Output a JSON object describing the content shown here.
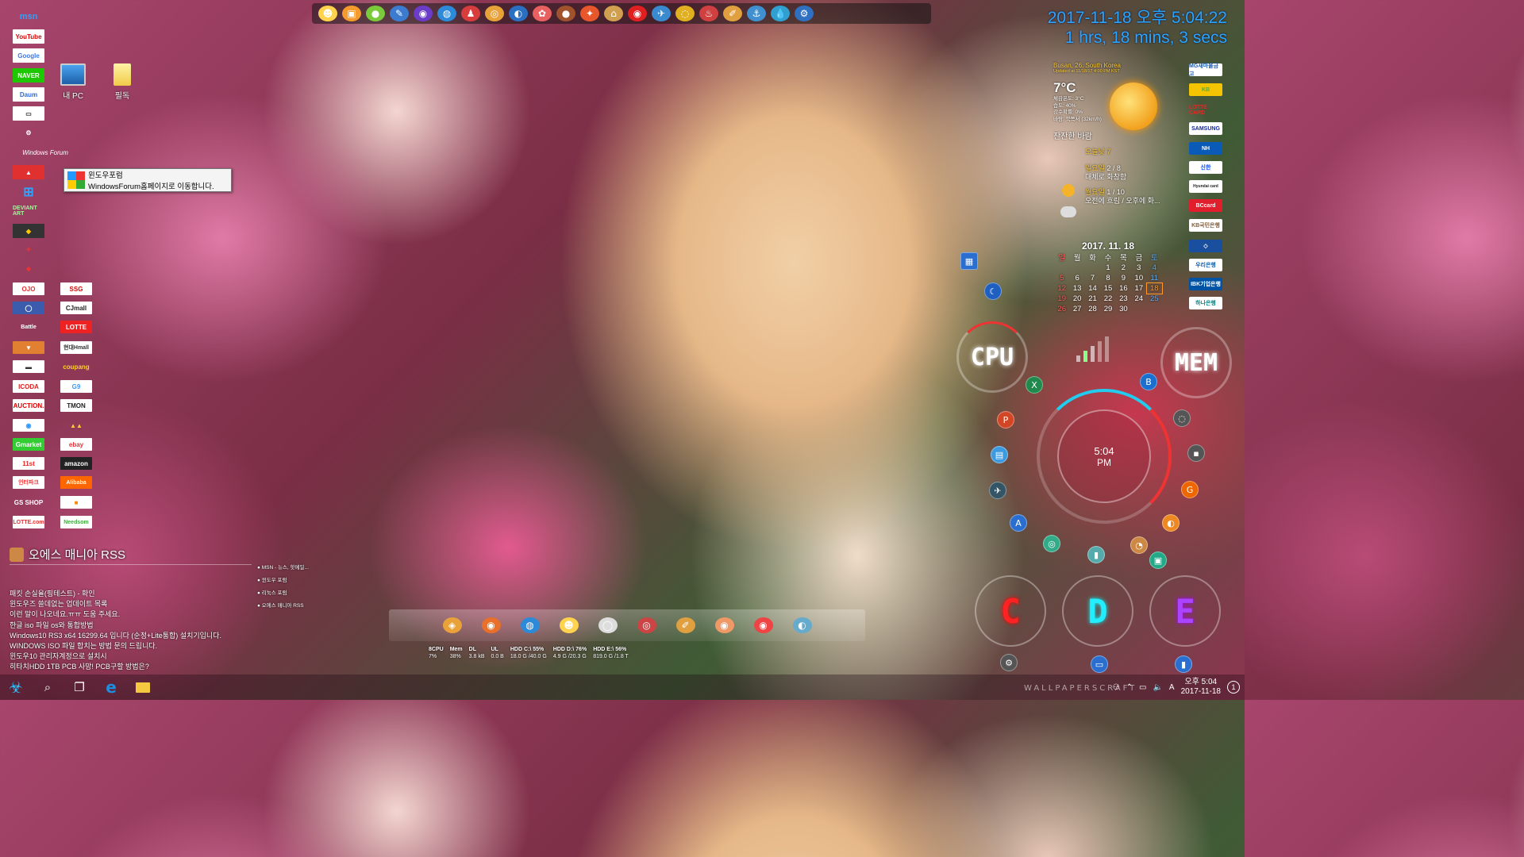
{
  "clock": {
    "datetime": "2017-11-18 오후 5:04:22",
    "uptime": "1 hrs, 18 mins, 3 secs"
  },
  "desktop_icons": [
    {
      "label": "내 PC"
    },
    {
      "label": "필독"
    }
  ],
  "tooltip": {
    "title": "윈도우포럼",
    "desc": "WindowsForum홈페이지로 이동합니다."
  },
  "left_shortcuts": [
    "msn",
    "YouTube",
    "Google",
    "NAVER",
    "Daum",
    "Windows Forum",
    "DEVIANT ART"
  ],
  "left_shortcuts_col2": [
    "CJmall",
    "LOTTE",
    "현대Hmall",
    "coupang",
    "G9",
    "TMON",
    "ebay",
    "amazon",
    "Alibaba",
    "Needsom"
  ],
  "left_shortcuts_col1b": [
    "Gmarket",
    "ICODA",
    "AUCTION.",
    "11st",
    "인터파크",
    "GS SHOP",
    "LOTTE.com"
  ],
  "rss": {
    "title": "오에스 매니아 RSS",
    "items": [
      "패킷 손실율(핑테스트) - 확인",
      "윈도우즈 쓸데없는 업데이트 목록",
      "이런 말이 나오네요.ㅠㅠ 도움 주세요.",
      "한글 iso 파일 os와 통합방법",
      "Windows10 RS3 x64 16299.64 입니다 (순정+Lite통합) 설치기입니다.",
      "WINDOWS ISO 파일 합치는 방법 문의 드립니다.",
      "윈도우10 관리자계정으로 설치시",
      "히타치HDD 1TB PCB 사망! PCB구할 방법은?"
    ],
    "links": [
      "MSN - 뉴스, 핫메일...",
      "윈도우 포럼",
      "리눅스 포럼",
      "오에스 매니아 RSS"
    ]
  },
  "weather": {
    "location": "Busan, 26, South Korea",
    "updated": "Updated at 11/18/17 4:00 PM KST",
    "temp": "7°C",
    "details": [
      "체감온도: 3°C",
      "습도: 40%",
      "강수확률: 0%",
      "바람: 북쪽서 (32km/h)"
    ],
    "condition": "잔잔한 바람",
    "today": "오늘낮 7",
    "forecast": [
      {
        "day": "일요일",
        "range": "2 / 8",
        "text": "대체로 화창함"
      },
      {
        "day": "월요일",
        "range": "1 / 10",
        "text": "오전에 흐림 / 오후에 화..."
      }
    ]
  },
  "calendar": {
    "header": "2017. 11. 18",
    "weekdays": [
      "일",
      "월",
      "화",
      "수",
      "목",
      "금",
      "토"
    ],
    "weeks": [
      [
        "",
        "",
        "",
        "1",
        "2",
        "3",
        "4"
      ],
      [
        "5",
        "6",
        "7",
        "8",
        "9",
        "10",
        "11"
      ],
      [
        "12",
        "13",
        "14",
        "15",
        "16",
        "17",
        "18"
      ],
      [
        "19",
        "20",
        "21",
        "22",
        "23",
        "24",
        "25"
      ],
      [
        "26",
        "27",
        "28",
        "29",
        "30",
        "",
        ""
      ]
    ],
    "today": "18"
  },
  "right_banks": [
    "MG새마을금고",
    "KB",
    "LOTTE CARD",
    "SAMSUNG",
    "NH",
    "신한",
    "Hyundai card",
    "BCcard",
    "KB국민은행",
    "우리은행",
    "IBK기업은행",
    "하나은행"
  ],
  "gauges": {
    "cpu": "CPU",
    "mem": "MEM",
    "clock_time": "5:04",
    "clock_ampm": "PM",
    "drives": [
      "C",
      "D",
      "E"
    ]
  },
  "sysmon": [
    {
      "label": "8CPU",
      "value": "7%"
    },
    {
      "label": "Mem",
      "value": "38%"
    },
    {
      "label": "DL",
      "value": "3.8 kB"
    },
    {
      "label": "UL",
      "value": "0.0 B"
    },
    {
      "label": "HDD C:\\ 55%",
      "value": "18.0 G /40.0 G"
    },
    {
      "label": "HDD D:\\ 76%",
      "value": "4.9 G /20.3 G"
    },
    {
      "label": "HDD E:\\ 56%",
      "value": "819.0 G /1.8 T"
    }
  ],
  "taskbar": {
    "time": "오후 5:04",
    "date": "2017-11-18",
    "notification_count": "1",
    "ime": "A",
    "watermark": "WALLPAPERSCRAFT"
  }
}
